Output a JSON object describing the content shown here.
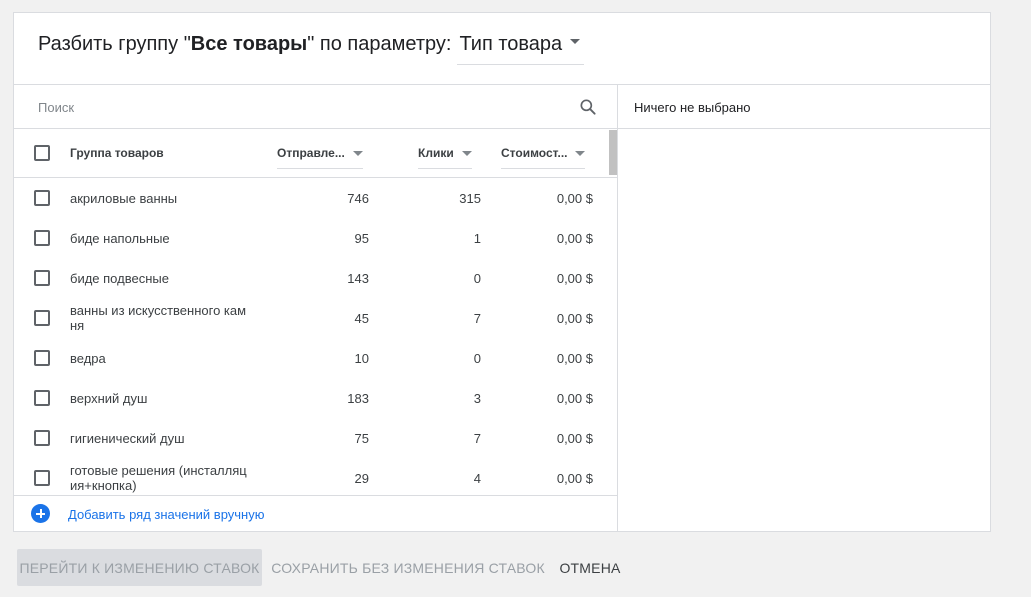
{
  "dialog": {
    "title_prefix": "Разбить группу \"",
    "group_name": "Все товары",
    "title_middle": "\" по параметру:",
    "dimension": "Тип товара"
  },
  "search": {
    "placeholder": "Поиск"
  },
  "right_panel": {
    "selection_text": "Ничего не выбрано"
  },
  "table": {
    "headers": {
      "group": "Группа товаров",
      "submitted": "Отправле...",
      "clicks": "Клики",
      "cost": "Стоимост..."
    },
    "rows": [
      {
        "name": "акриловые ванны",
        "submitted": "746",
        "clicks": "315",
        "cost": "0,00 $"
      },
      {
        "name": "биде напольные",
        "submitted": "95",
        "clicks": "1",
        "cost": "0,00 $"
      },
      {
        "name": "биде подвесные",
        "submitted": "143",
        "clicks": "0",
        "cost": "0,00 $"
      },
      {
        "name": "ванны из искусственного кам ня",
        "submitted": "45",
        "clicks": "7",
        "cost": "0,00 $"
      },
      {
        "name": "ведра",
        "submitted": "10",
        "clicks": "0",
        "cost": "0,00 $"
      },
      {
        "name": "верхний душ",
        "submitted": "183",
        "clicks": "3",
        "cost": "0,00 $"
      },
      {
        "name": "гигиенический душ",
        "submitted": "75",
        "clicks": "7",
        "cost": "0,00 $"
      },
      {
        "name": "готовые решения (инсталляц ия+кнопка)",
        "submitted": "29",
        "clicks": "4",
        "cost": "0,00 $"
      }
    ]
  },
  "add_row": {
    "label": "Добавить ряд значений вручную"
  },
  "footer": {
    "primary": "ПЕРЕЙТИ К ИЗМЕНЕНИЮ СТАВОК",
    "save": "СОХРАНИТЬ БЕЗ ИЗМЕНЕНИЯ СТАВОК",
    "cancel": "ОТМЕНА"
  },
  "colors": {
    "accent": "#1a73e8",
    "border": "#dadce0",
    "background": "#f1f1f1"
  }
}
